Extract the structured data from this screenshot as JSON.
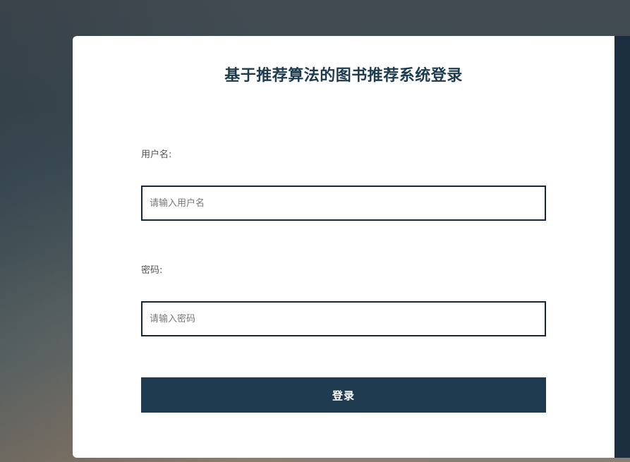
{
  "login": {
    "title": "基于推荐算法的图书推荐系统登录",
    "username_label": "用户名:",
    "username_placeholder": "请输入用户名",
    "username_value": "",
    "password_label": "密码:",
    "password_placeholder": "请输入密码",
    "password_value": "",
    "submit_label": "登录"
  },
  "colors": {
    "title": "#1d3a4e",
    "button_bg": "#1e3b50",
    "input_border": "#13263a",
    "side_strip": "#1c2f3e"
  }
}
